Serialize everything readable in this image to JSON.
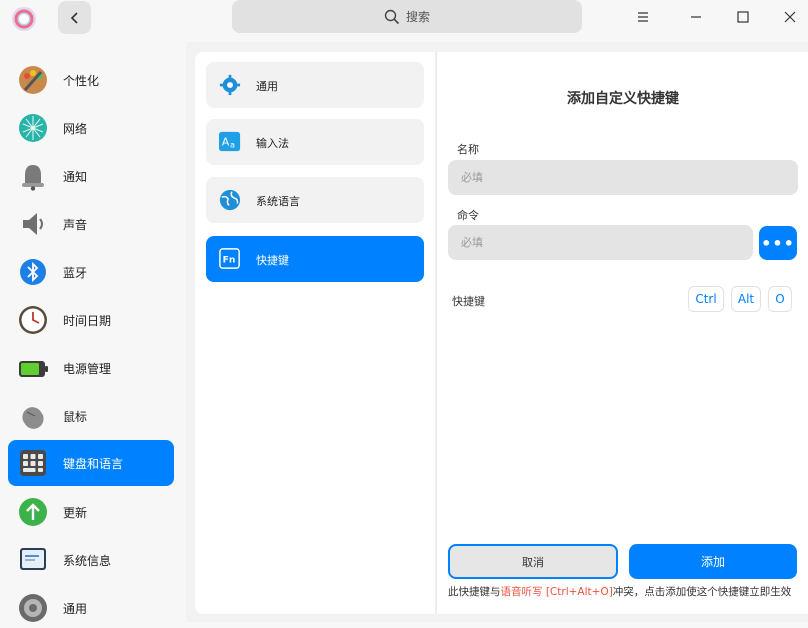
{
  "header": {
    "search_placeholder": "搜索"
  },
  "sidebar": {
    "items": [
      {
        "label": "个性化",
        "icon": "personalization-icon"
      },
      {
        "label": "网络",
        "icon": "network-icon"
      },
      {
        "label": "通知",
        "icon": "bell-icon"
      },
      {
        "label": "声音",
        "icon": "speaker-icon"
      },
      {
        "label": "蓝牙",
        "icon": "bluetooth-icon"
      },
      {
        "label": "时间日期",
        "icon": "clock-icon"
      },
      {
        "label": "电源管理",
        "icon": "battery-icon"
      },
      {
        "label": "鼠标",
        "icon": "mouse-icon"
      },
      {
        "label": "键盘和语言",
        "icon": "keyboard-icon",
        "active": true
      },
      {
        "label": "更新",
        "icon": "update-icon"
      },
      {
        "label": "系统信息",
        "icon": "system-info-icon"
      },
      {
        "label": "通用",
        "icon": "general-icon"
      }
    ]
  },
  "submenu": {
    "items": [
      {
        "label": "通用",
        "icon": "gear-icon"
      },
      {
        "label": "输入法",
        "icon": "input-method-icon"
      },
      {
        "label": "系统语言",
        "icon": "globe-icon"
      },
      {
        "label": "快捷键",
        "icon": "fn-key-icon",
        "active": true
      }
    ]
  },
  "dialog": {
    "title": "添加自定义快捷键",
    "name_label": "名称",
    "name_placeholder": "必填",
    "command_label": "命令",
    "command_placeholder": "必填",
    "browse_label": "•••",
    "shortcut_label": "快捷键",
    "keys": [
      "Ctrl",
      "Alt",
      "O"
    ],
    "cancel_label": "取消",
    "add_label": "添加",
    "conflict_prefix": "此快捷键与",
    "conflict_target": "语音听写 [Ctrl+Alt+O]",
    "conflict_suffix": "冲突，点击添加使这个快捷键立即生效"
  },
  "colors": {
    "accent": "#0081ff",
    "conflict": "#e8533a"
  }
}
